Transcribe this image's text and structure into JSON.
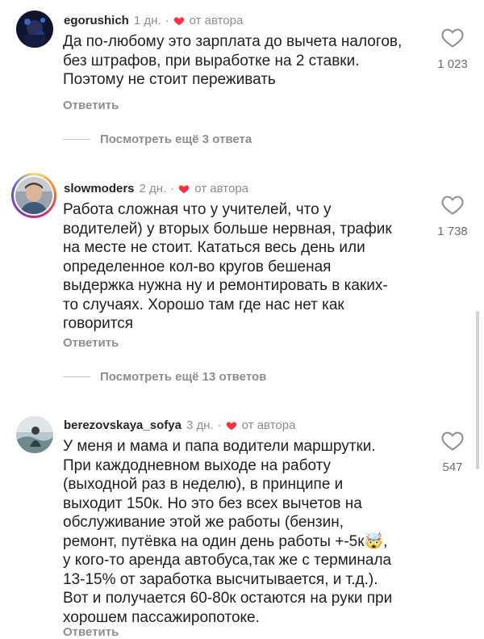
{
  "comments": [
    {
      "username": "egorushich",
      "age": "1 дн.",
      "dot": "·",
      "author_badge": "от автора",
      "text": "Да по-любому это зарплата до вычета налогов,\nбез штрафов, при выработке на 2 ставки.\nПоэтому не стоит переживать",
      "reply_label": "Ответить",
      "likes": "1 023",
      "more_replies": "Посмотреть ещё 3 ответа"
    },
    {
      "username": "slowmoders",
      "age": "2 дн.",
      "dot": "·",
      "author_badge": "от автора",
      "text": "Работа сложная что у учителей, что у\nводителей) у вторых больше нервная, трафик\nна месте не стоит. Кататься весь день или\nопределенное кол-во кругов бешеная\nвыдержка нужна ну и ремонтировать в каких-\nто случаях. Хорошо там где нас нет как\nговорится",
      "reply_label": "Ответить",
      "likes": "1 738",
      "more_replies": "Посмотреть ещё 13 ответов"
    },
    {
      "username": "berezovskaya_sofya",
      "age": "3 дн.",
      "dot": "·",
      "author_badge": "от автора",
      "text": "У меня и мама и папа водители маршрутки.\nПри каждодневном выходе на работу\n(выходной раз в неделю), в принципе и\nвыходит 150к. Но это без всех вычетов на\nобслуживание этой же работы (бензин,\nремонт, путёвка на один день работы +-5к🤯,\nу кого-то аренда автобуса,так же с терминала\n13-15% от заработка высчитывается, и т.д.).\nВот и получается 60-80к остаются на руки при\nхорошем пассажиропотоке.",
      "reply_label": "Ответить",
      "likes": "547"
    }
  ],
  "icons": {
    "like": "heart-outline-icon",
    "author_like": "heart-filled-icon"
  },
  "colors": {
    "author_heart": "#ff3040",
    "muted_text": "#8e8e8e"
  }
}
